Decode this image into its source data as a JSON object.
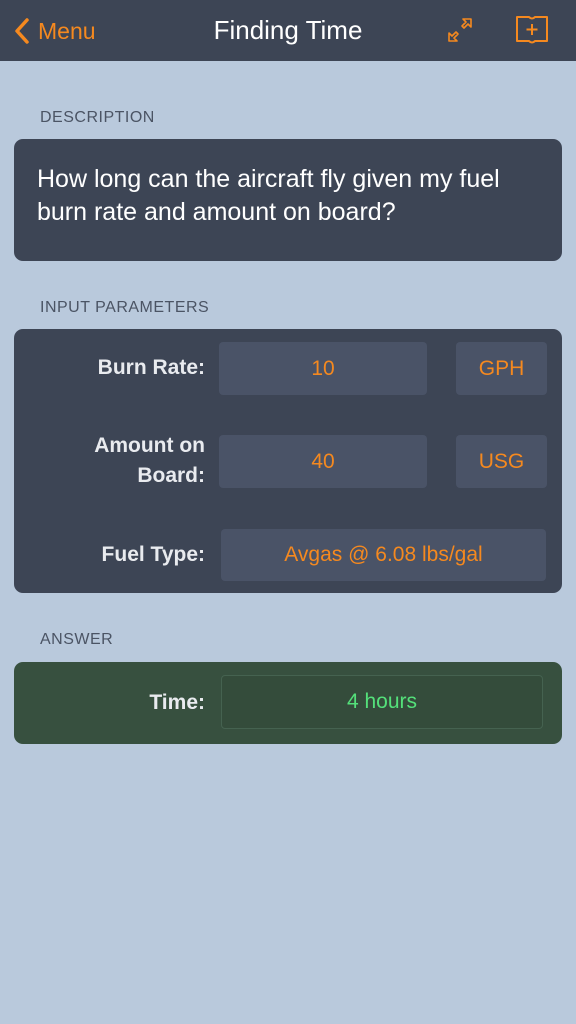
{
  "nav": {
    "back_label": "Menu",
    "title": "Finding Time",
    "accent_color": "#f5891f"
  },
  "description": {
    "section_label": "DESCRIPTION",
    "text": "How long can the aircraft fly given my fuel burn rate and amount on board?"
  },
  "inputs": {
    "section_label": "INPUT PARAMETERS",
    "burn_rate": {
      "label": "Burn Rate:",
      "value": "10",
      "unit": "GPH"
    },
    "amount": {
      "label_line1": "Amount on",
      "label_line2": "Board:",
      "value": "40",
      "unit": "USG"
    },
    "fuel_type": {
      "label": "Fuel Type:",
      "value": "Avgas @ 6.08 lbs/gal"
    }
  },
  "answer": {
    "section_label": "ANSWER",
    "time_label": "Time:",
    "time_value": "4 hours",
    "answer_color": "#54e07a"
  },
  "icons": [
    "chevron-left-icon",
    "expand-arrows-icon",
    "add-bookmark-icon"
  ]
}
